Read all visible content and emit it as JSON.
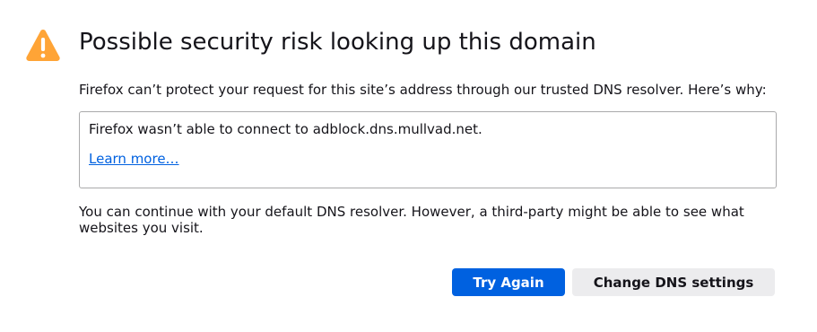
{
  "colors": {
    "warning_icon": "#ffa436",
    "primary_button": "#0061e0",
    "link": "#0061e0",
    "secondary_button": "#ececee"
  },
  "icon": "warning-triangle-icon",
  "title": "Possible security risk looking up this domain",
  "intro": "Firefox can’t protect your request for this site’s address through our trusted DNS resolver. Here’s why:",
  "details": {
    "message": "Firefox wasn’t able to connect to adblock.dns.mullvad.net.",
    "learn_more": "Learn more…"
  },
  "note": "You can continue with your default DNS resolver. However, a third-party might be able to see what websites you visit.",
  "buttons": {
    "try_again": "Try Again",
    "change_dns": "Change DNS settings"
  }
}
